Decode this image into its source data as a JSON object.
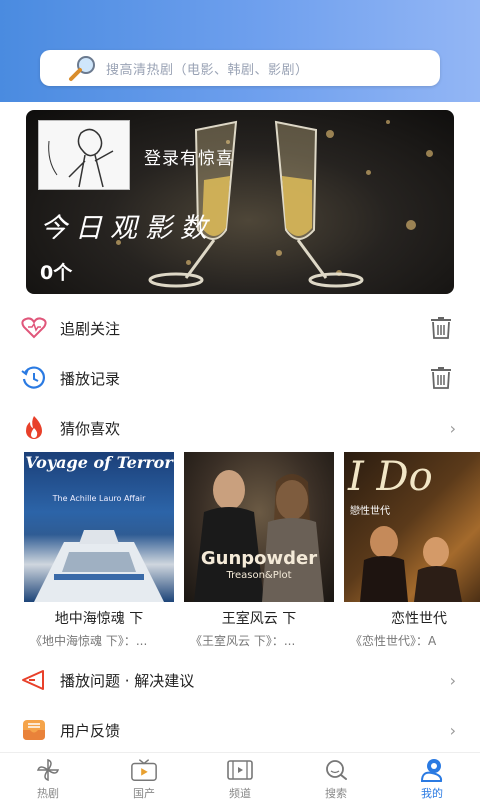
{
  "search": {
    "placeholder": "搜高清热剧（电影、韩剧、影剧）"
  },
  "banner": {
    "login_text": "登录有惊喜",
    "today_title": "今日观影数",
    "count": "0个"
  },
  "menu": {
    "follow_label": "追剧关注",
    "history_label": "播放记录",
    "guess_label": "猜你喜欢",
    "problem_label": "播放问题 · 解决建议",
    "feedback_label": "用户反馈"
  },
  "recommendations": [
    {
      "title": "地中海惊魂 下",
      "desc": "《地中海惊魂 下》：...",
      "poster_text": "Voyage of Terror",
      "poster_sub": "The Achille Lauro Affair"
    },
    {
      "title": "王室风云 下",
      "desc": "《王室风云 下》：...",
      "poster_text": "Gunpowder",
      "poster_sub": "Treason&Plot"
    },
    {
      "title": "恋性世代",
      "desc": "《恋性世代》：A",
      "poster_text": "I Do",
      "poster_sub": "戀性世代"
    }
  ],
  "tabs": [
    {
      "label": "热剧",
      "icon": "pinwheel-icon"
    },
    {
      "label": "国产",
      "icon": "tv-icon"
    },
    {
      "label": "频道",
      "icon": "film-icon"
    },
    {
      "label": "搜索",
      "icon": "search-icon"
    },
    {
      "label": "我的",
      "icon": "profile-icon",
      "active": true
    }
  ],
  "colors": {
    "accent": "#2a7ae2",
    "header_gradient_start": "#4a8be0",
    "header_gradient_end": "#93b6f5"
  }
}
